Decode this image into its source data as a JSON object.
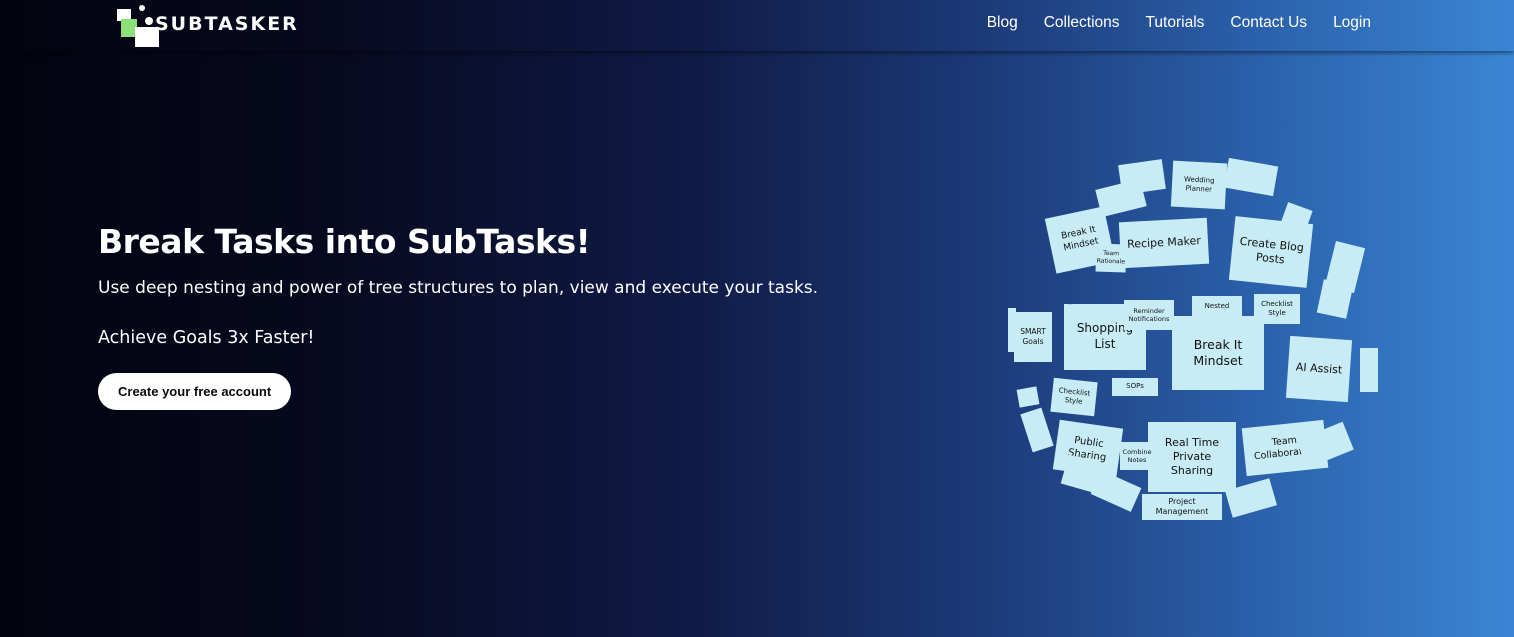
{
  "brand": {
    "name": "SUBTASKER",
    "logo_colors": [
      "#ffffff",
      "#8ce07a"
    ]
  },
  "nav": {
    "links": [
      "Blog",
      "Collections",
      "Tutorials",
      "Contact Us",
      "Login"
    ]
  },
  "hero": {
    "title": "Break Tasks into SubTasks!",
    "subtitle": "Use deep nesting and power of tree structures to plan, view and execute your tasks.",
    "goal": "Achieve Goals 3x Faster!",
    "cta_label": "Create your free account"
  },
  "globe": {
    "card_color": "#c8ecf6",
    "cards": [
      "Recipe Maker",
      "Create Blog Posts",
      "Break It Mindset",
      "Shopping List",
      "Break It Mindset",
      "AI Assist",
      "Real Time Private Sharing",
      "Public Sharing",
      "Team Collaboration",
      "Team Rationale",
      "Reminder Notifications",
      "Nested",
      "Checklist Style",
      "Public",
      "SMART Goals",
      "Checklist Style",
      "SOPs",
      "Combine Notes",
      "Project Management",
      "Wedding Planner"
    ]
  }
}
